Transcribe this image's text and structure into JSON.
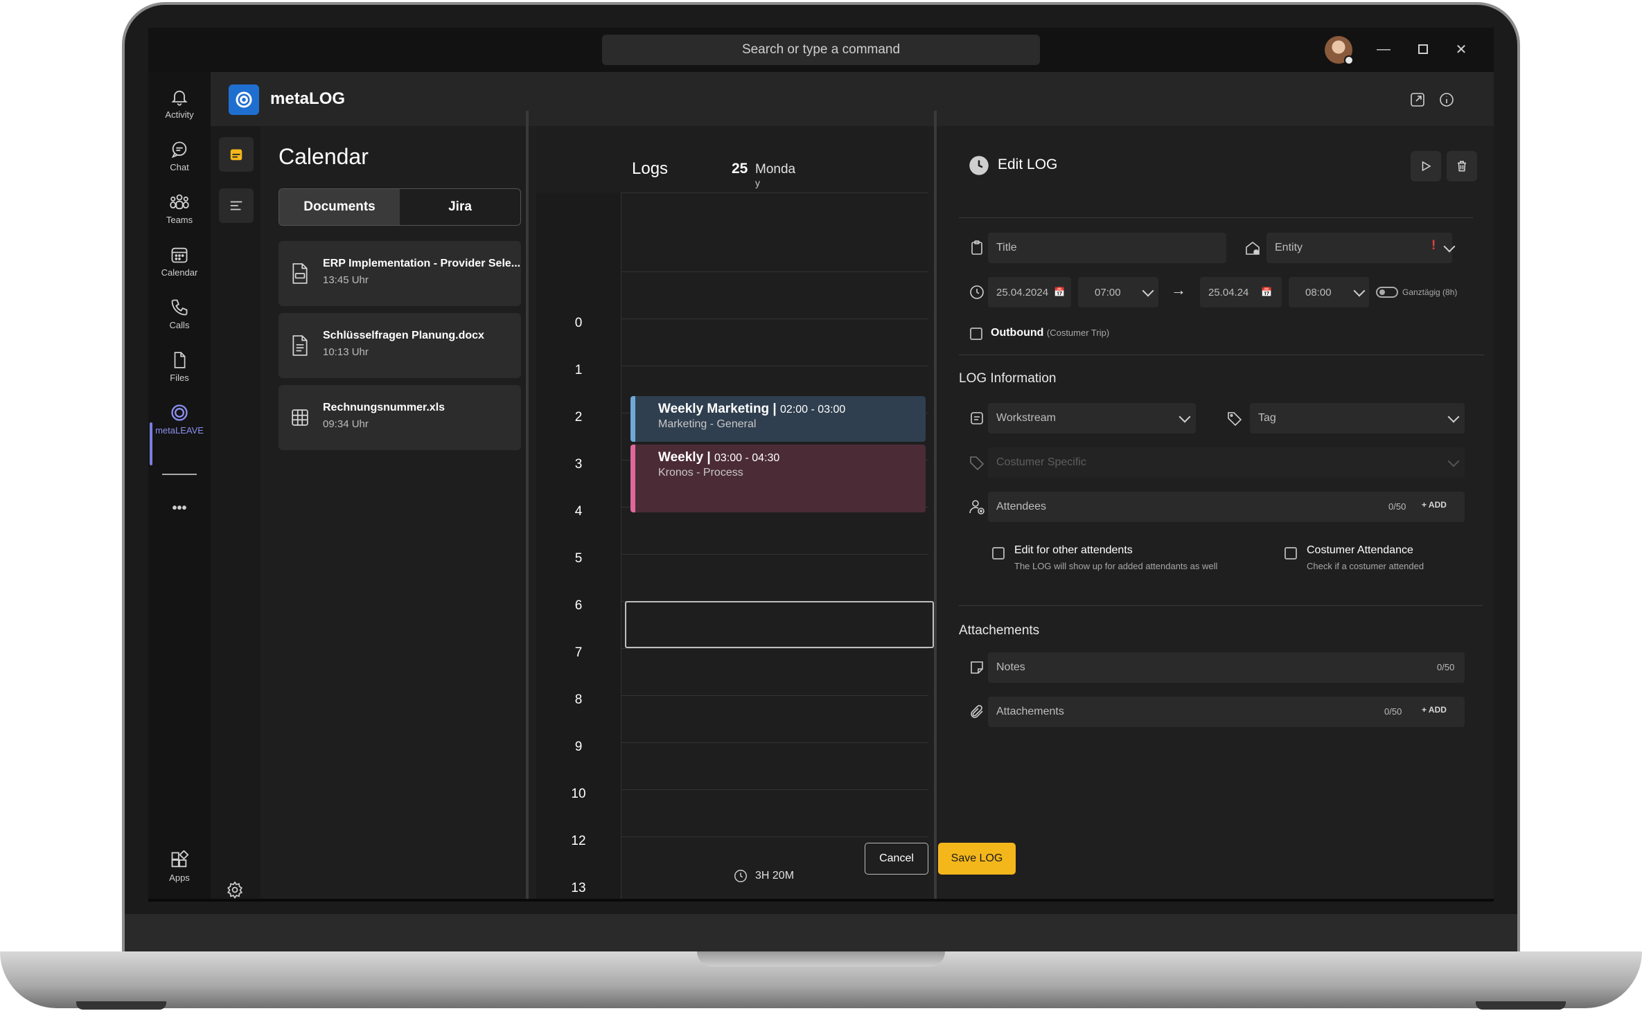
{
  "titlebar": {
    "search_placeholder": "Search or type a command"
  },
  "rail": {
    "items": [
      {
        "label": "Activity",
        "icon": "bell-icon"
      },
      {
        "label": "Chat",
        "icon": "chat-icon"
      },
      {
        "label": "Teams",
        "icon": "teams-icon"
      },
      {
        "label": "Calendar",
        "icon": "calendar-icon"
      },
      {
        "label": "Calls",
        "icon": "phone-icon"
      },
      {
        "label": "Files",
        "icon": "file-icon"
      },
      {
        "label": "metaLEAVE",
        "icon": "metaleave-icon"
      }
    ],
    "more": "•••",
    "apps": "Apps"
  },
  "app": {
    "name": "metaLOG",
    "accent": "#1f6fd1"
  },
  "calendar": {
    "title": "Calendar",
    "tabs": [
      "Documents",
      "Jira"
    ],
    "documents": [
      {
        "name": "ERP Implementation - Provider Sele...",
        "time": "13:45 Uhr",
        "icon": "pdf-file-icon"
      },
      {
        "name": "Schlüsselfragen Planung.docx",
        "time": "10:13 Uhr",
        "icon": "document-file-icon"
      },
      {
        "name": "Rechnungsnummer.xls",
        "time": "09:34 Uhr",
        "icon": "spreadsheet-icon"
      }
    ]
  },
  "logs": {
    "title": "Logs",
    "day_number": "25",
    "day_name": "Monda",
    "day_name_wrap": "y",
    "hours": [
      "0",
      "1",
      "2",
      "3",
      "4",
      "5",
      "6",
      "7",
      "8",
      "9",
      "10",
      "12",
      "13"
    ],
    "events": [
      {
        "title": "Weekly Marketing |",
        "time": "02:00 - 03:00",
        "subtitle": "Marketing - General",
        "color": "#6fa8d8",
        "bg": "#2f3f4f"
      },
      {
        "title": "Weekly |",
        "time": "03:00 - 04:30",
        "subtitle": "Kronos - Process",
        "color": "#e0679a",
        "bg": "#4b2b36"
      }
    ],
    "duration": "3H 20M"
  },
  "edit": {
    "title": "Edit LOG",
    "title_placeholder": "Title",
    "entity_placeholder": "Entity",
    "required_mark": "!",
    "start_date": "25.04.2024",
    "start_time": "07:00",
    "arrow": "→",
    "end_date": "25.04.24",
    "end_time": "08:00",
    "allday_label": "Ganztägig (8h)",
    "outbound_label": "Outbound",
    "outbound_note": "(Costumer Trip)",
    "info_section": "LOG Information",
    "workstream_placeholder": "Workstream",
    "tag_placeholder": "Tag",
    "customer_specific_placeholder": "Costumer Specific",
    "attendees_placeholder": "Attendees",
    "attendees_count": "0/50",
    "add_label": "ADD",
    "edit_others_label": "Edit for other attendents",
    "edit_others_note": "The LOG will show up for added attendants as well",
    "customer_attendance_label": "Costumer Attendance",
    "customer_attendance_note": "Check if a costumer attended",
    "attachments_section": "Attachements",
    "notes_placeholder": "Notes",
    "notes_count": "0/50",
    "attachments_placeholder": "Attachements",
    "attachments_count": "0/50",
    "cancel_label": "Cancel",
    "save_label": "Save LOG",
    "save_color": "#f4b71b"
  }
}
